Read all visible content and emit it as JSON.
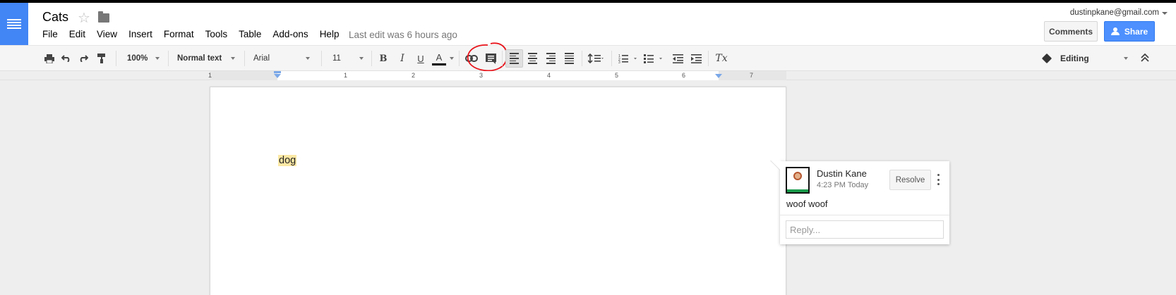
{
  "header": {
    "doc_title": "Cats",
    "account_email": "dustinpkane@gmail.com",
    "last_edit": "Last edit was 6 hours ago",
    "comments_label": "Comments",
    "share_label": "Share",
    "brand_color": "#4285f4",
    "menu": [
      "File",
      "Edit",
      "View",
      "Insert",
      "Format",
      "Tools",
      "Table",
      "Add-ons",
      "Help"
    ]
  },
  "toolbar": {
    "zoom": "100%",
    "style": "Normal text",
    "font": "Arial",
    "font_size": "11",
    "bold": "B",
    "italic": "I",
    "underline": "U",
    "text_color": "A",
    "clear_formatting": "Tx",
    "mode": "Editing",
    "icons": [
      "print-icon",
      "undo-icon",
      "redo-icon",
      "paint-format-icon",
      "link-icon",
      "comment-icon",
      "align-left-icon",
      "align-center-icon",
      "align-right-icon",
      "justify-icon",
      "line-spacing-icon",
      "numbered-list-icon",
      "bulleted-list-icon",
      "decrease-indent-icon",
      "increase-indent-icon",
      "clear-formatting-icon",
      "pencil-icon",
      "collapse-icon"
    ]
  },
  "ruler": {
    "labels": [
      "1",
      "1",
      "2",
      "3",
      "4",
      "5",
      "6",
      "7"
    ]
  },
  "document": {
    "text": "dog",
    "highlight_color": "#fce8a4"
  },
  "comment": {
    "author": "Dustin Kane",
    "time": "4:23 PM Today",
    "body": "woof woof",
    "resolve_label": "Resolve",
    "reply_placeholder": "Reply..."
  }
}
